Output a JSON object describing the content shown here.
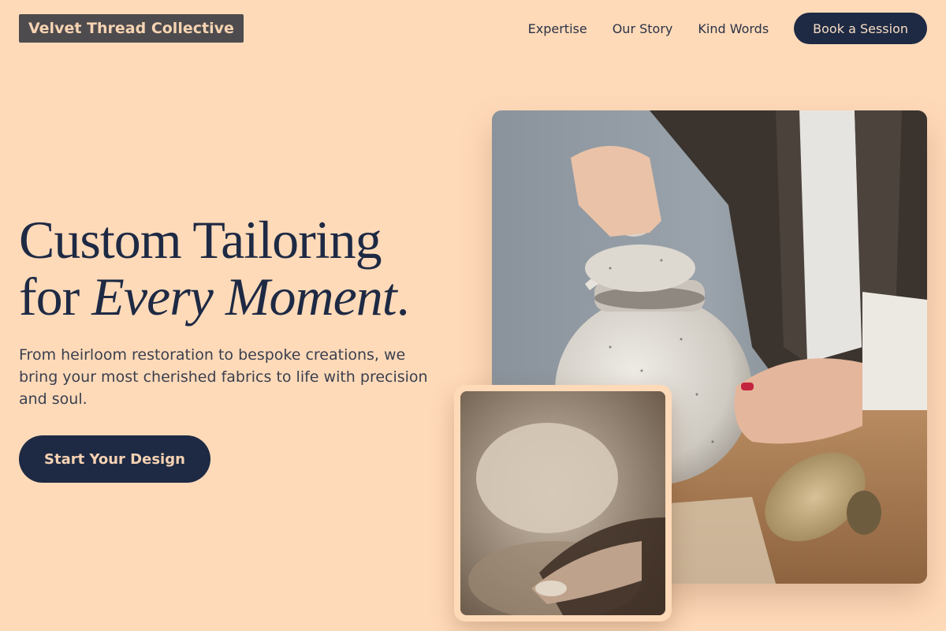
{
  "brand": {
    "name": "Velvet Thread Collective"
  },
  "nav": {
    "links": [
      "Expertise",
      "Our Story",
      "Kind Words"
    ],
    "cta": "Book a Session"
  },
  "hero": {
    "title_line1": "Custom Tailoring",
    "title_for": "for ",
    "title_em": "Every Moment",
    "title_dot": ".",
    "subtitle": "From heirloom restoration to bespoke creations, we bring your most cherished fabrics to life with precision and soul.",
    "cta": "Start Your Design"
  },
  "images": {
    "main": "ceramic-jar-photo",
    "secondary": "flour-hands-photo"
  },
  "colors": {
    "background": "#ffdab9",
    "navy": "#1e2a44",
    "logo_bg": "#4e4b4e"
  }
}
